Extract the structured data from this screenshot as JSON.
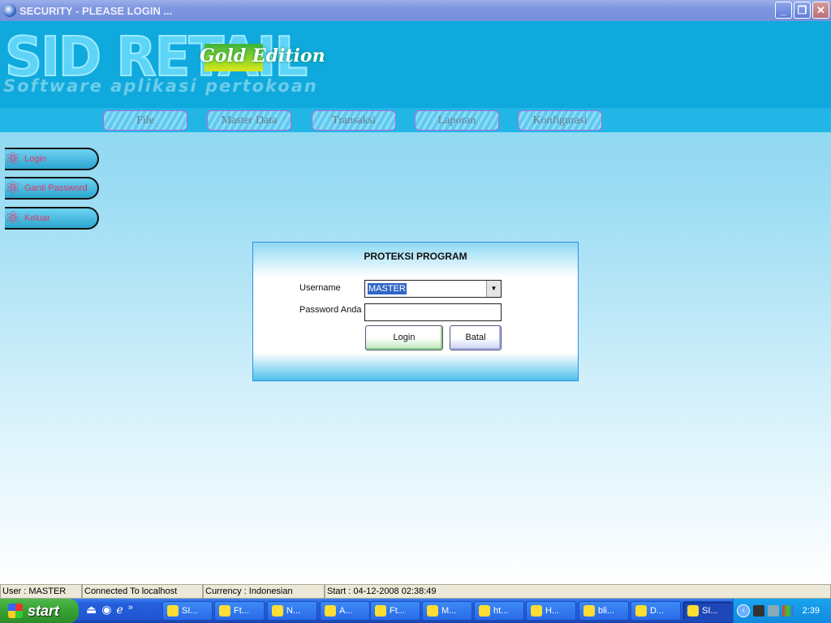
{
  "window": {
    "title": "SECURITY - PLEASE LOGIN ...",
    "minimize": "_",
    "restore": "❐",
    "close": "✕"
  },
  "header": {
    "logo": "SID RETAIL",
    "edition": "Gold Edition",
    "tagline": "Software aplikasi pertokoan"
  },
  "menu": [
    {
      "label": "File"
    },
    {
      "label": "Master Data"
    },
    {
      "label": "Transaksi"
    },
    {
      "label": "Laporan"
    },
    {
      "label": "Konfigurasi"
    }
  ],
  "sidebar": [
    {
      "label": "Login"
    },
    {
      "label": "Ganti Password"
    },
    {
      "label": "Keluar"
    }
  ],
  "dialog": {
    "title": "PROTEKSI PROGRAM",
    "username_label": "Username",
    "username_value": "MASTER",
    "password_label": "Password Anda",
    "password_value": "",
    "login_button": "Login",
    "cancel_button": "Batal"
  },
  "status": {
    "user": "User : MASTER",
    "connection": "Connected To localhost",
    "currency": "Currency : Indonesian",
    "start": "Start  : 04-12-2008 02:38:49"
  },
  "taskbar": {
    "start": "start",
    "quicklaunch_more": "»",
    "tasks": [
      {
        "label": "SI...",
        "icon": "folder-icon"
      },
      {
        "label": "Ft...",
        "icon": "ftp-icon"
      },
      {
        "label": "N...",
        "icon": "hs-icon"
      },
      {
        "label": "A...",
        "icon": "app-icon"
      },
      {
        "label": "Ft...",
        "icon": "ftp-icon"
      },
      {
        "label": "M...",
        "icon": "m-icon"
      },
      {
        "label": "ht...",
        "icon": "opera-icon"
      },
      {
        "label": "H...",
        "icon": "chrome-icon"
      },
      {
        "label": "bli...",
        "icon": "zip-icon"
      },
      {
        "label": "D...",
        "icon": "ftp-icon"
      },
      {
        "label": "SI...",
        "icon": "sid-icon",
        "active": true
      }
    ],
    "clock": "2:39"
  }
}
